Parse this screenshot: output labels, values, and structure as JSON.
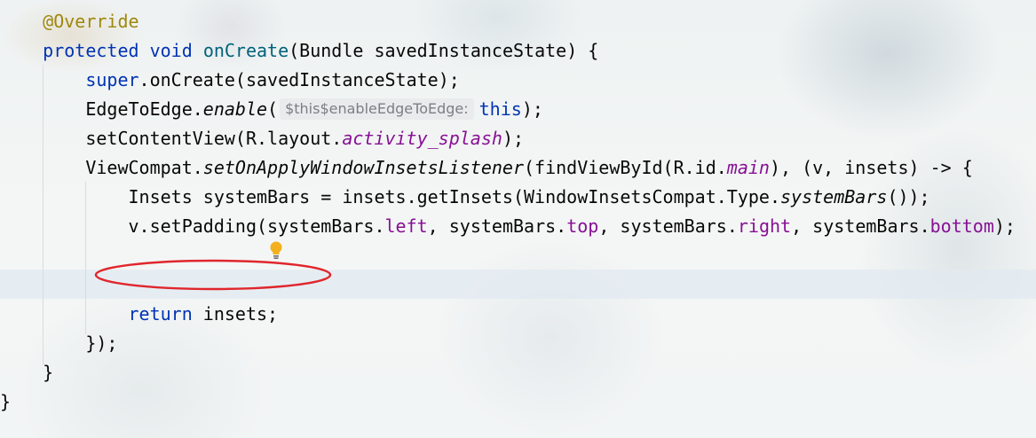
{
  "editor": {
    "lines": [
      {
        "indent": "    ",
        "tokens": [
          {
            "t": "@Override",
            "c": "ann"
          }
        ]
      },
      {
        "indent": "    ",
        "tokens": [
          {
            "t": "protected",
            "c": "kw"
          },
          {
            "t": " "
          },
          {
            "t": "void",
            "c": "kw"
          },
          {
            "t": " "
          },
          {
            "t": "onCreate",
            "c": "fn"
          },
          {
            "t": "(Bundle savedInstanceState) {"
          }
        ]
      },
      {
        "indent": "        ",
        "tokens": [
          {
            "t": "super",
            "c": "kw"
          },
          {
            "t": ".onCreate(savedInstanceState);"
          }
        ]
      },
      {
        "indent": "        ",
        "tokens": [
          {
            "t": "EdgeToEdge."
          },
          {
            "t": "enable",
            "c": "st"
          },
          {
            "t": "("
          },
          {
            "t": "$this$enableEdgeToEdge:",
            "c": "hint"
          },
          {
            "t": "this",
            "c": "kw"
          },
          {
            "t": ");"
          }
        ]
      },
      {
        "indent": "        ",
        "tokens": [
          {
            "t": "setContentView(R.layout."
          },
          {
            "t": "activity_splash",
            "c": "sf"
          },
          {
            "t": ");"
          }
        ]
      },
      {
        "indent": "        ",
        "tokens": [
          {
            "t": "ViewCompat."
          },
          {
            "t": "setOnApplyWindowInsetsListener",
            "c": "st"
          },
          {
            "t": "(findViewById(R.id."
          },
          {
            "t": "main",
            "c": "sf"
          },
          {
            "t": "), (v, insets) -> {"
          }
        ]
      },
      {
        "indent": "            ",
        "tokens": [
          {
            "t": "Insets systemBars = insets.getInsets(WindowInsetsCompat.Type."
          },
          {
            "t": "systemBars",
            "c": "st"
          },
          {
            "t": "());"
          }
        ]
      },
      {
        "indent": "            ",
        "tokens": [
          {
            "t": "v.setPadding(systemBars."
          },
          {
            "t": "left",
            "c": "fld"
          },
          {
            "t": ", systemBars."
          },
          {
            "t": "top",
            "c": "fld"
          },
          {
            "t": ", systemBars."
          },
          {
            "t": "right",
            "c": "fld"
          },
          {
            "t": ", systemBars."
          },
          {
            "t": "bottom",
            "c": "fld"
          },
          {
            "t": ");"
          }
        ]
      },
      {
        "indent": "",
        "tokens": []
      },
      {
        "indent": "",
        "tokens": []
      },
      {
        "indent": "            ",
        "tokens": [
          {
            "t": "return",
            "c": "kw"
          },
          {
            "t": " insets;"
          }
        ]
      },
      {
        "indent": "        ",
        "tokens": [
          {
            "t": "});"
          }
        ]
      },
      {
        "indent": "    ",
        "tokens": [
          {
            "t": "}"
          }
        ]
      },
      {
        "indent": "",
        "tokens": [
          {
            "t": "}"
          }
        ]
      }
    ],
    "highlighted_line": 10,
    "intention_icon": "lightbulb-icon",
    "colors": {
      "annotation": "#9e880d",
      "keyword": "#0033b3",
      "method": "#00627a",
      "field": "#871094",
      "hint": "#7b7f85",
      "annotation_ellipse": "#e0262d",
      "bulb": "#f2b01e"
    }
  }
}
